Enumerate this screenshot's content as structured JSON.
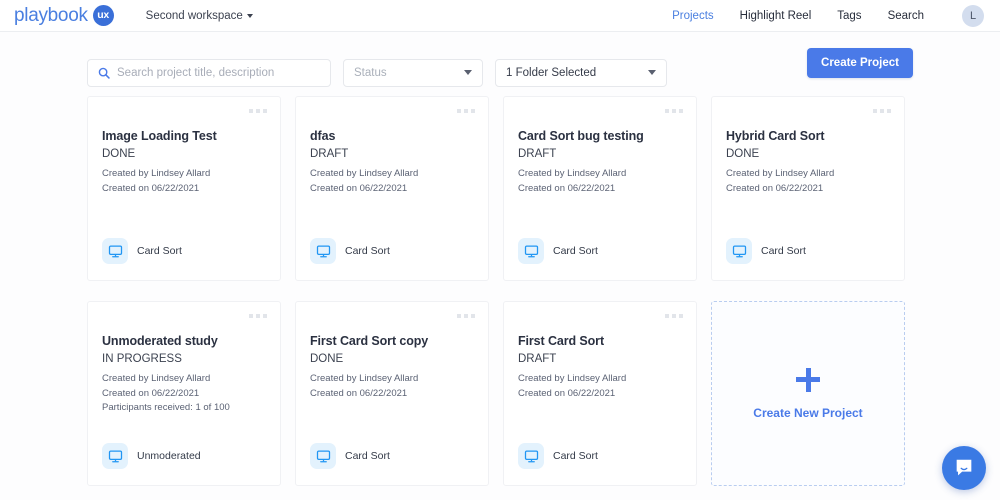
{
  "header": {
    "logo_text": "playbook",
    "logo_badge": "ux",
    "workspace": "Second workspace",
    "nav": [
      {
        "label": "Projects",
        "active": true
      },
      {
        "label": "Highlight Reel",
        "active": false
      },
      {
        "label": "Tags",
        "active": false
      },
      {
        "label": "Search",
        "active": false
      }
    ],
    "avatar_initial": "L"
  },
  "toolbar": {
    "search_placeholder": "Search project title, description",
    "search_value": "",
    "status_label": "Status",
    "folder_label": "1 Folder Selected",
    "create_button": "Create Project"
  },
  "projects": [
    {
      "title": "Image Loading Test",
      "status": "DONE",
      "created_by": "Created by Lindsey Allard",
      "created_on": "Created on 06/22/2021",
      "participants": "",
      "type": "Card Sort"
    },
    {
      "title": "dfas",
      "status": "DRAFT",
      "created_by": "Created by Lindsey Allard",
      "created_on": "Created on 06/22/2021",
      "participants": "",
      "type": "Card Sort"
    },
    {
      "title": "Card Sort bug testing",
      "status": "DRAFT",
      "created_by": "Created by Lindsey Allard",
      "created_on": "Created on 06/22/2021",
      "participants": "",
      "type": "Card Sort"
    },
    {
      "title": "Hybrid Card Sort",
      "status": "DONE",
      "created_by": "Created by Lindsey Allard",
      "created_on": "Created on 06/22/2021",
      "participants": "",
      "type": "Card Sort"
    },
    {
      "title": "Unmoderated study",
      "status": "IN PROGRESS",
      "created_by": "Created by Lindsey Allard",
      "created_on": "Created on 06/22/2021",
      "participants": "Participants received: 1 of 100",
      "type": "Unmoderated"
    },
    {
      "title": "First Card Sort copy",
      "status": "DONE",
      "created_by": "Created by Lindsey Allard",
      "created_on": "Created on 06/22/2021",
      "participants": "",
      "type": "Card Sort"
    },
    {
      "title": "First Card Sort",
      "status": "DRAFT",
      "created_by": "Created by Lindsey Allard",
      "created_on": "Created on 06/22/2021",
      "participants": "",
      "type": "Card Sort"
    }
  ],
  "new_project_card": {
    "label": "Create New Project"
  },
  "colors": {
    "brand_blue": "#4a7ae8",
    "logo_blue": "#4a7fe0",
    "icon_bg": "#e3f2fd",
    "page_bg": "#fdfdfe",
    "dashed_border": "#b9cdf0"
  }
}
